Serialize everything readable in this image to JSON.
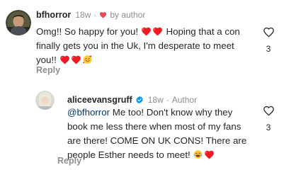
{
  "comments": [
    {
      "username": "bfhorror",
      "time": "18w",
      "separator": "·",
      "author_tag": "by author",
      "text_before": "Omg!! So happy for you! ",
      "text_middle": " Hoping that a con finally gets you in the Uk, I'm desperate to meet you!! ",
      "reply_label": "Reply",
      "like_count": "3",
      "icons": [
        "heart-mini-icon",
        "red-heart-emoji",
        "smiling-hearts-emoji",
        "like-heart-outline-icon"
      ]
    },
    {
      "username": "aliceevansgruff",
      "time": "18w",
      "separator": "·",
      "author_label": "Author",
      "mention": "@bfhorror",
      "text": " Me too! Don't know why they book me less there when most of my fans are there! COME ON UK CONS! There are people Esther needs to meet! ",
      "reply_label": "Reply",
      "like_count": "3",
      "icons": [
        "verified-badge-icon",
        "tears-of-joy-emoji",
        "red-heart-emoji",
        "like-heart-outline-icon"
      ]
    }
  ],
  "colors": {
    "text": "#262626",
    "secondary": "#8e8e8e",
    "mention": "#00376b",
    "heart": "#ed4956",
    "verified": "#0095f6"
  }
}
